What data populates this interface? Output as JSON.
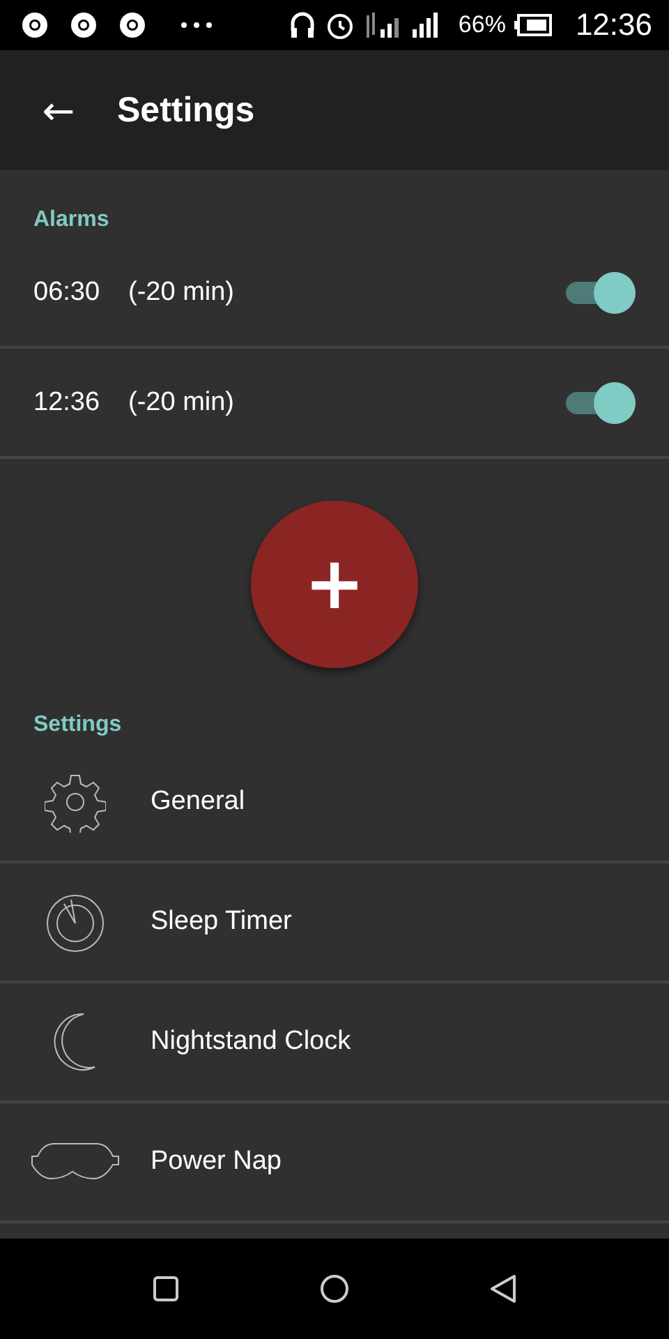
{
  "status_bar": {
    "battery": "66%",
    "time": "12:36"
  },
  "app_bar": {
    "back": "←",
    "title": "Settings"
  },
  "alarms": {
    "header": "Alarms",
    "items": [
      {
        "time": "06:30",
        "offset": "(-20 min)",
        "on": true
      },
      {
        "time": "12:36",
        "offset": "(-20 min)",
        "on": true
      }
    ]
  },
  "add_button": "+",
  "settings": {
    "header": "Settings",
    "items": [
      {
        "kind": "gear",
        "label": "General"
      },
      {
        "kind": "timer",
        "label": "Sleep Timer"
      },
      {
        "kind": "moon",
        "label": "Nightstand Clock"
      },
      {
        "kind": "mask",
        "label": "Power Nap"
      }
    ]
  }
}
